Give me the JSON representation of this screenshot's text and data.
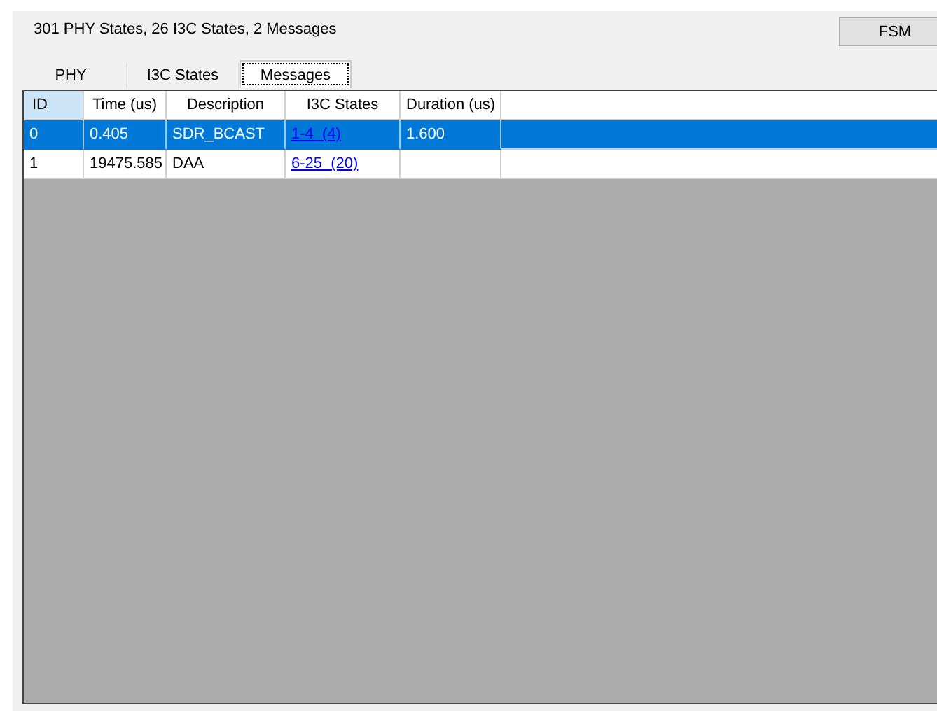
{
  "summary": "301 PHY States, 26 I3C States, 2 Messages",
  "fsm_button": "FSM",
  "tabs": [
    {
      "label": "PHY",
      "selected": false
    },
    {
      "label": "I3C States",
      "selected": false
    },
    {
      "label": "Messages",
      "selected": true
    }
  ],
  "table": {
    "columns": [
      {
        "label": "ID",
        "selected": true
      },
      {
        "label": "Time (us)",
        "selected": false
      },
      {
        "label": "Description",
        "selected": false
      },
      {
        "label": "I3C States",
        "selected": false
      },
      {
        "label": "Duration (us)",
        "selected": false
      }
    ],
    "rows": [
      {
        "selected": true,
        "cells": [
          "0",
          "0.405",
          "SDR_BCAST",
          "1-4  (4)",
          "1.600"
        ]
      },
      {
        "selected": false,
        "cells": [
          "1",
          "19475.585",
          "DAA",
          "6-25  (20)",
          ""
        ]
      }
    ]
  }
}
